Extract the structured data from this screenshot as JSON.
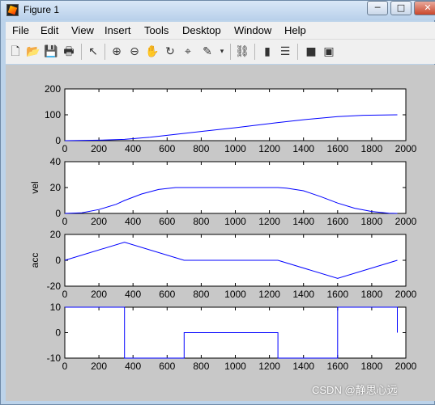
{
  "window": {
    "title": "Figure 1"
  },
  "controls": {
    "minimize": "─",
    "maximize": "□",
    "close": "✕"
  },
  "menu": [
    "File",
    "Edit",
    "View",
    "Insert",
    "Tools",
    "Desktop",
    "Window",
    "Help"
  ],
  "toolbar": [
    {
      "name": "new-figure-icon",
      "glyph": "🗋"
    },
    {
      "name": "open-file-icon",
      "glyph": "📂"
    },
    {
      "name": "save-icon",
      "glyph": "💾"
    },
    {
      "name": "print-icon",
      "glyph": "🖶"
    },
    {
      "name": "edit-plot-arrow-icon",
      "glyph": "↖"
    },
    {
      "name": "zoom-in-icon",
      "glyph": "⊕"
    },
    {
      "name": "zoom-out-icon",
      "glyph": "⊖"
    },
    {
      "name": "pan-hand-icon",
      "glyph": "✋"
    },
    {
      "name": "rotate-3d-icon",
      "glyph": "↻"
    },
    {
      "name": "data-cursor-icon",
      "glyph": "⌖"
    },
    {
      "name": "brush-icon",
      "glyph": "✎"
    },
    {
      "name": "link-plot-icon",
      "glyph": "⛓"
    },
    {
      "name": "colorbar-icon",
      "glyph": "▮"
    },
    {
      "name": "legend-icon",
      "glyph": "☰"
    },
    {
      "name": "hide-plot-tools-icon",
      "glyph": "■"
    },
    {
      "name": "show-plot-tools-icon",
      "glyph": "▣"
    }
  ],
  "colors": {
    "line": "#0000ff",
    "figure_bg": "#c8c8c8",
    "axes_bg": "#ffffff"
  },
  "watermark": "CSDN @静思心远",
  "chart_data": [
    {
      "type": "line",
      "xlabel": "",
      "ylabel": "",
      "xlim": [
        0,
        2000
      ],
      "ylim": [
        0,
        200
      ],
      "xticks": [
        "0",
        "200",
        "400",
        "600",
        "800",
        "1000",
        "1200",
        "1400",
        "1600",
        "1800",
        "2000"
      ],
      "yticks": [
        "0",
        "100",
        "200"
      ],
      "series": [
        {
          "x": [
            0,
            200,
            350,
            500,
            700,
            1000,
            1250,
            1400,
            1600,
            1750,
            1950
          ],
          "y": [
            0,
            2,
            5,
            13,
            28,
            50,
            70,
            81,
            93,
            98,
            100
          ]
        }
      ]
    },
    {
      "type": "line",
      "xlabel": "",
      "ylabel": "vel",
      "xlim": [
        0,
        2000
      ],
      "ylim": [
        0,
        40
      ],
      "xticks": [
        "0",
        "200",
        "400",
        "600",
        "800",
        "1000",
        "1200",
        "1400",
        "1600",
        "1800",
        "2000"
      ],
      "yticks": [
        "0",
        "20",
        "40"
      ],
      "series": [
        {
          "x": [
            0,
            100,
            200,
            300,
            350,
            450,
            550,
            650,
            700,
            1250,
            1300,
            1400,
            1500,
            1600,
            1700,
            1800,
            1900,
            1950
          ],
          "y": [
            0,
            0.5,
            3,
            7,
            10,
            15,
            18.5,
            20,
            20,
            20,
            19.5,
            17.5,
            13,
            8,
            4,
            1.5,
            0.2,
            0
          ]
        }
      ]
    },
    {
      "type": "line",
      "xlabel": "",
      "ylabel": "acc",
      "xlim": [
        0,
        2000
      ],
      "ylim": [
        -20,
        20
      ],
      "xticks": [
        "0",
        "200",
        "400",
        "600",
        "800",
        "1000",
        "1200",
        "1400",
        "1600",
        "1800",
        "2000"
      ],
      "yticks": [
        "-20",
        "0",
        "20"
      ],
      "series": [
        {
          "x": [
            0,
            350,
            700,
            1250,
            1600,
            1950
          ],
          "y": [
            0,
            14,
            0,
            0,
            -14,
            0
          ]
        }
      ]
    },
    {
      "type": "line",
      "xlabel": "",
      "ylabel": "",
      "xlim": [
        0,
        2000
      ],
      "ylim": [
        -10,
        10
      ],
      "xticks": [
        "0",
        "200",
        "400",
        "600",
        "800",
        "1000",
        "1200",
        "1400",
        "1600",
        "1800",
        "2000"
      ],
      "yticks": [
        "-10",
        "0",
        "10"
      ],
      "series": [
        {
          "x": [
            0,
            350,
            350,
            700,
            700,
            1250,
            1250,
            1600,
            1600,
            1950,
            1950
          ],
          "y": [
            10,
            10,
            -10,
            -10,
            0,
            0,
            -10,
            -10,
            10,
            10,
            0
          ]
        }
      ]
    }
  ]
}
